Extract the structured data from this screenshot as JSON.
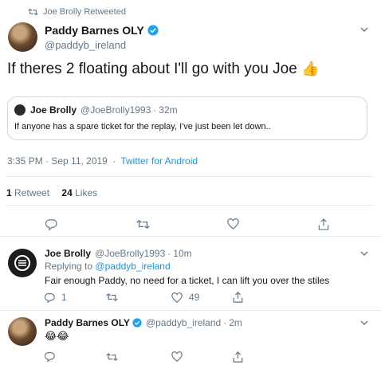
{
  "retweet_banner": {
    "text": "Joe Brolly Retweeted"
  },
  "main_tweet": {
    "author_name": "Paddy Barnes OLY",
    "author_handle": "@paddyb_ireland",
    "text": "If theres 2 floating about I'll go with you Joe",
    "text_emoji": "👍",
    "quoted": {
      "author_name": "Joe Brolly",
      "author_handle": "@JoeBrolly1993",
      "time": "32m",
      "text": "If anyone has a spare ticket for the replay, I've just been let down.."
    },
    "timestamp": "3:35 PM · Sep 11, 2019",
    "source": "Twitter for Android",
    "stats": {
      "retweets_count": "1",
      "retweets_label": "Retweet",
      "likes_count": "24",
      "likes_label": "Likes"
    }
  },
  "replies": [
    {
      "author_name": "Joe Brolly",
      "author_handle": "@JoeBrolly1993",
      "time": "10m",
      "replying_to_label": "Replying to",
      "replying_to_handle": "@paddyb_ireland",
      "text": "Fair enough Paddy, no need for a ticket, I can lift you over the stiles",
      "reply_count": "1",
      "retweet_count": "",
      "like_count": "49"
    },
    {
      "author_name": "Paddy Barnes OLY",
      "author_handle": "@paddyb_ireland",
      "time": "2m",
      "text": "😂😂"
    }
  ],
  "separator": "·",
  "colors": {
    "link": "#1b95e0",
    "muted": "#657786",
    "text": "#14171a",
    "divider": "#e6ecf0"
  },
  "icons": [
    "retweet-icon",
    "verified-icon",
    "chevron-down-icon",
    "reply-icon",
    "like-icon",
    "share-icon"
  ]
}
